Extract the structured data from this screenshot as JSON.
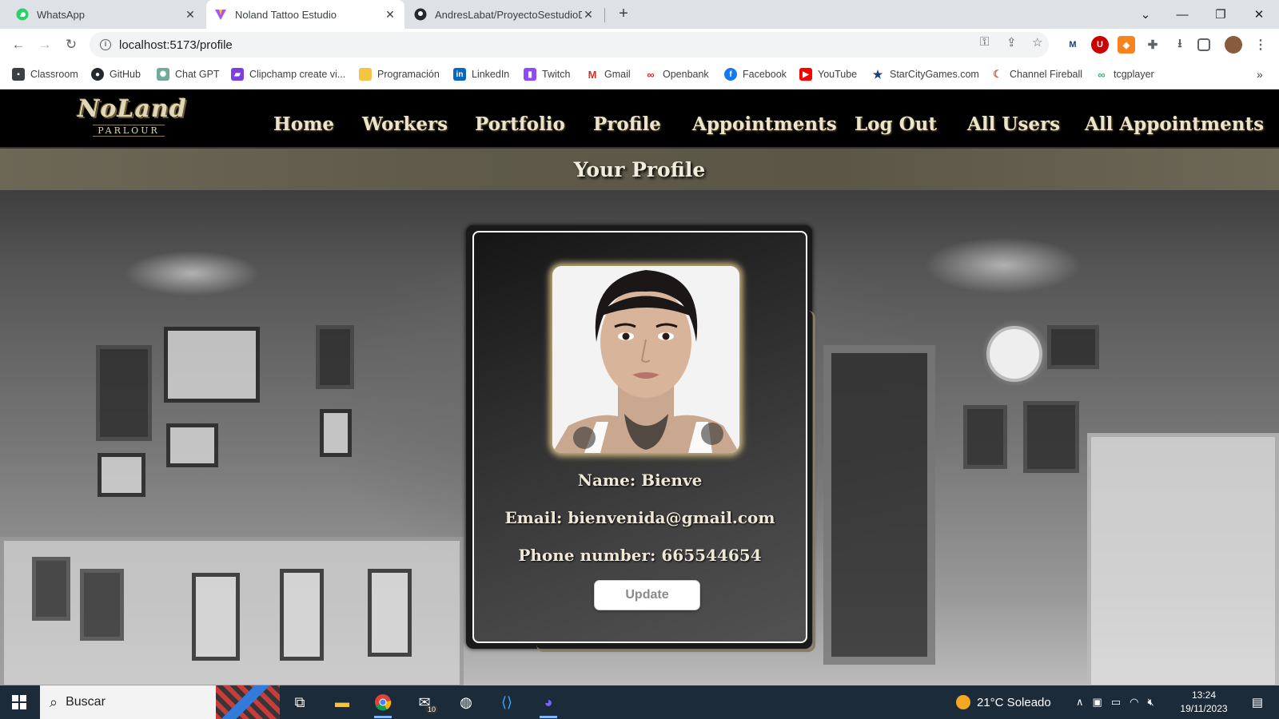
{
  "browser": {
    "tabs": [
      {
        "title": "WhatsApp"
      },
      {
        "title": "Noland Tattoo Estudio"
      },
      {
        "title": "AndresLabat/ProyectoSestudioD"
      }
    ],
    "url": "localhost:5173/profile",
    "bookmarks": [
      {
        "label": "Classroom",
        "color": "#3c4043"
      },
      {
        "label": "GitHub",
        "color": "#24292f"
      },
      {
        "label": "Chat GPT",
        "color": "#74aa9c"
      },
      {
        "label": "Clipchamp create vi...",
        "color": "#7b3fe4"
      },
      {
        "label": "Programación",
        "color": "#f4c542"
      },
      {
        "label": "LinkedIn",
        "color": "#0a66c2"
      },
      {
        "label": "Twitch",
        "color": "#9146ff"
      },
      {
        "label": "Gmail",
        "color": "#d93025"
      },
      {
        "label": "Openbank",
        "color": "#e2231a"
      },
      {
        "label": "Facebook",
        "color": "#1877f2"
      },
      {
        "label": "YouTube",
        "color": "#ff0000"
      },
      {
        "label": "StarCityGames.com",
        "color": "#1a3d7c"
      },
      {
        "label": "Channel Fireball",
        "color": "#e8502e"
      },
      {
        "label": "tcgplayer",
        "color": "#2bb673"
      }
    ]
  },
  "site": {
    "logo": {
      "top": "NoLand",
      "bottom": "PARLOUR"
    },
    "nav": [
      "Home",
      "Workers",
      "Portfolio",
      "Profile",
      "Appointments",
      "Log Out",
      "All Users",
      "All Appointments"
    ],
    "page_title": "Your Profile"
  },
  "profile": {
    "name_line": "Name: Bienve",
    "email_line": "Email: bienvenida@gmail.com",
    "phone_line": "Phone number: 665544654",
    "update_label": "Update"
  },
  "taskbar": {
    "search_placeholder": "Buscar",
    "mail_badge": "10",
    "weather": "21°C Soleado",
    "time": "13:24",
    "date": "19/11/2023"
  }
}
